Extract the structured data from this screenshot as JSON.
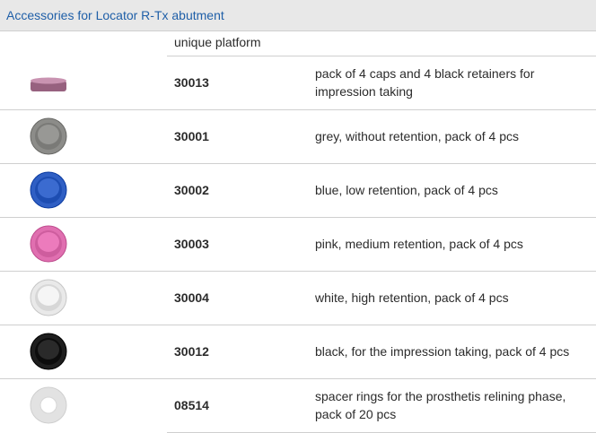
{
  "header": {
    "title": "Accessories for Locator R-Tx abutment"
  },
  "columns": {
    "platform_label": "unique platform"
  },
  "items": [
    {
      "code": "30013",
      "description": "pack of 4 caps and 4 black retainers for impression taking",
      "part": "impression-cap",
      "color": "#b07a98"
    },
    {
      "code": "30001",
      "description": "grey, without retention, pack of 4 pcs",
      "part": "retention-insert",
      "color": "#8c8c89"
    },
    {
      "code": "30002",
      "description": "blue, low retention, pack of 4 pcs",
      "part": "retention-insert",
      "color": "#2f5fc4"
    },
    {
      "code": "30003",
      "description": "pink, medium retention, pack of 4 pcs",
      "part": "retention-insert",
      "color": "#e06fb0"
    },
    {
      "code": "30004",
      "description": "white, high retention, pack of 4 pcs",
      "part": "retention-insert",
      "color": "#e9e9e9"
    },
    {
      "code": "30012",
      "description": "black, for the impression taking, pack of 4 pcs",
      "part": "retention-insert",
      "color": "#1e1e1e"
    },
    {
      "code": "08514",
      "description": "spacer rings for the prosthetis relining phase, pack of 20 pcs",
      "part": "spacer-ring",
      "color": "#e2e2e2"
    }
  ]
}
